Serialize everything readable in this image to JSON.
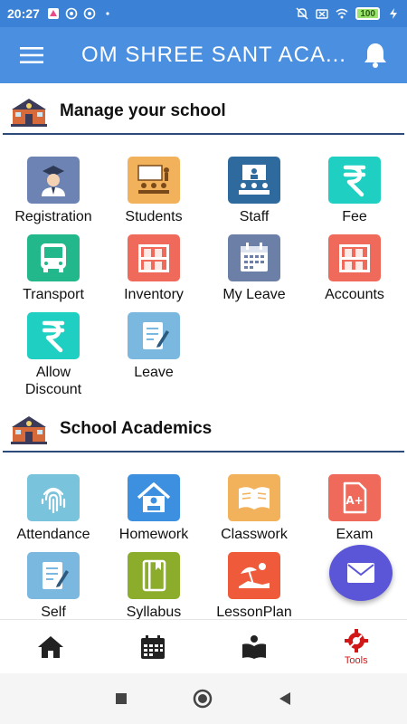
{
  "status_bar": {
    "time": "20:27",
    "battery": "100"
  },
  "app_bar": {
    "title": "OM SHREE SANT ACA...",
    "menu_icon": "hamburger-icon",
    "bell_icon": "bell-icon"
  },
  "sections": [
    {
      "title": "Manage your school",
      "items": [
        {
          "label": "Registration",
          "icon": "graduate-icon",
          "color": "#6d83b4"
        },
        {
          "label": "Students",
          "icon": "classroom-icon",
          "color": "#f2b25c"
        },
        {
          "label": "Staff",
          "icon": "staff-board-icon",
          "color": "#2e6a9e"
        },
        {
          "label": "Fee",
          "icon": "rupee-icon",
          "color": "#1fcfc1"
        },
        {
          "label": "Transport",
          "icon": "bus-icon",
          "color": "#22b88c"
        },
        {
          "label": "Inventory",
          "icon": "shelf-icon",
          "color": "#ef6a5a"
        },
        {
          "label": "My Leave",
          "icon": "calendar-icon",
          "color": "#6c7fa6"
        },
        {
          "label": "Accounts",
          "icon": "shelf-icon",
          "color": "#ef6a5a"
        },
        {
          "label": "Allow Discount",
          "icon": "rupee-icon",
          "color": "#1fcfc1"
        },
        {
          "label": "Leave",
          "icon": "edit-doc-icon",
          "color": "#7ab8e0"
        }
      ]
    },
    {
      "title": "School Academics",
      "items": [
        {
          "label": "Attendance",
          "icon": "fingerprint-icon",
          "color": "#7ac3dc"
        },
        {
          "label": "Homework",
          "icon": "home-study-icon",
          "color": "#3d8fe0"
        },
        {
          "label": "Classwork",
          "icon": "open-book-icon",
          "color": "#f2b25c"
        },
        {
          "label": "Exam",
          "icon": "grade-doc-icon",
          "color": "#ef6a5a"
        },
        {
          "label": "Self",
          "icon": "edit-doc-icon",
          "color": "#7ab8e0"
        },
        {
          "label": "Syllabus",
          "icon": "book-icon",
          "color": "#8cad2b"
        },
        {
          "label": "LessonPlan",
          "icon": "beach-icon",
          "color": "#ef5b3a"
        }
      ]
    }
  ],
  "fab": {
    "icon": "mail-icon",
    "color": "#5b55d8"
  },
  "bottom_nav": [
    {
      "icon": "home-icon",
      "label": ""
    },
    {
      "icon": "calendar-icon",
      "label": ""
    },
    {
      "icon": "book-open-icon",
      "label": ""
    },
    {
      "icon": "tools-gear-icon",
      "label": "Tools",
      "active": true,
      "color": "#d11818"
    }
  ]
}
